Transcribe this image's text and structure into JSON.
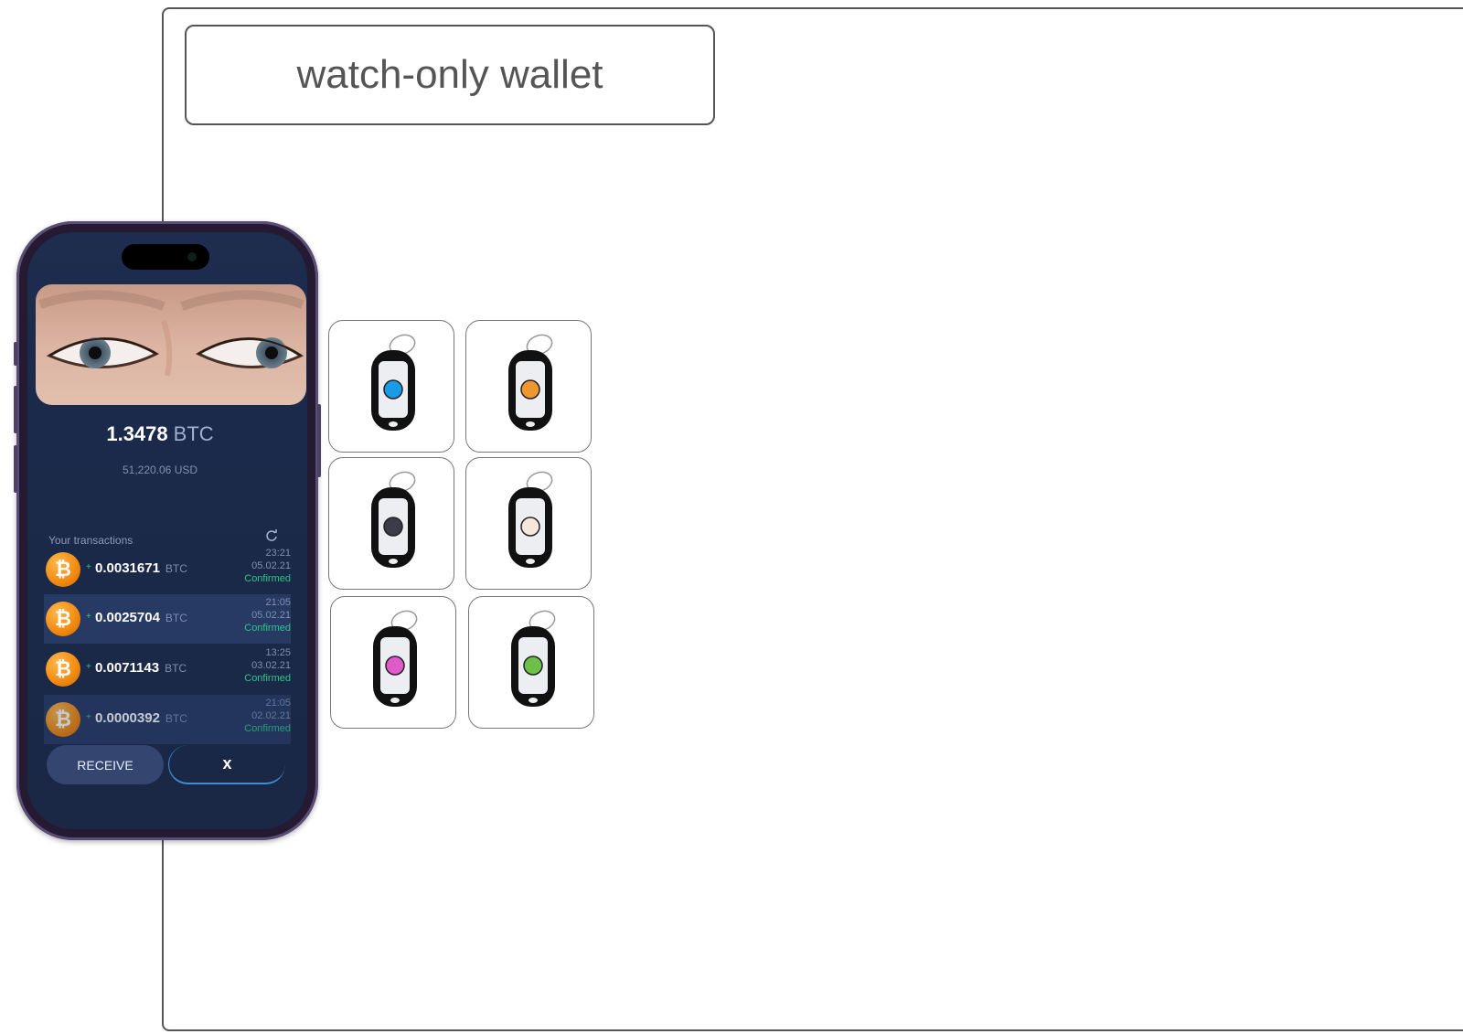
{
  "page": {
    "title": "watch-only wallet"
  },
  "phone": {
    "balance": {
      "amount": "1.3478",
      "unit": "BTC",
      "fiat": "51,220.06 USD"
    },
    "transactions_label": "Your transactions",
    "transactions": [
      {
        "sign": "+",
        "amount": "0.0031671",
        "unit": "BTC",
        "time": "23:21",
        "date": "05.02.21",
        "status": "Confirmed"
      },
      {
        "sign": "+",
        "amount": "0.0025704",
        "unit": "BTC",
        "time": "21:05",
        "date": "05.02.21",
        "status": "Confirmed"
      },
      {
        "sign": "+",
        "amount": "0.0071143",
        "unit": "BTC",
        "time": "13:25",
        "date": "03.02.21",
        "status": "Confirmed"
      },
      {
        "sign": "+",
        "amount": "0.0000392",
        "unit": "BTC",
        "time": "21:05",
        "date": "02.02.21",
        "status": "Confirmed"
      }
    ],
    "coin_symbol": "₿",
    "buttons": {
      "receive": "RECEIVE",
      "close": "x"
    }
  },
  "tags": [
    {
      "color": "#1a9be6"
    },
    {
      "color": "#f0962f"
    },
    {
      "color": "#3a3d46"
    },
    {
      "color": "#f7e6da"
    },
    {
      "color": "#e05ac9"
    },
    {
      "color": "#6cc04a"
    }
  ]
}
